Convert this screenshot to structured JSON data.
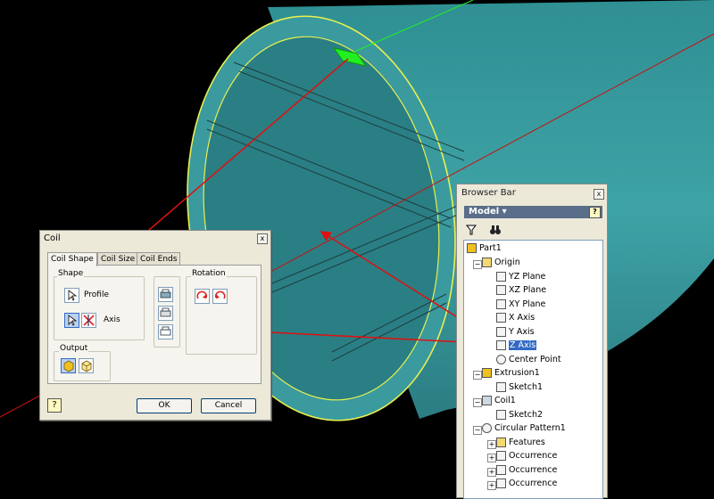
{
  "coil_dialog": {
    "title": "Coil",
    "tabs": [
      "Coil Shape",
      "Coil Size",
      "Coil Ends"
    ],
    "shape_group": "Shape",
    "profile_label": "Profile",
    "axis_label": "Axis",
    "rotation_group": "Rotation",
    "output_group": "Output",
    "ok_label": "OK",
    "cancel_label": "Cancel",
    "close_glyph": "x",
    "help_glyph": "?"
  },
  "browser_bar": {
    "title": "Browser Bar",
    "model_label": "Model ▾",
    "close_glyph": "x",
    "help_glyph": "?",
    "tree": [
      {
        "label": "Part1",
        "icon": "part-icon"
      },
      {
        "label": "Origin",
        "icon": "folder-icon"
      },
      {
        "label": "YZ Plane",
        "icon": "plane-icon"
      },
      {
        "label": "XZ Plane",
        "icon": "plane-icon"
      },
      {
        "label": "XY Plane",
        "icon": "plane-icon"
      },
      {
        "label": "X Axis",
        "icon": "axis-icon"
      },
      {
        "label": "Y Axis",
        "icon": "axis-icon"
      },
      {
        "label": "Z Axis",
        "icon": "axis-icon",
        "selected": true
      },
      {
        "label": "Center Point",
        "icon": "point-icon"
      },
      {
        "label": "Extrusion1",
        "icon": "extrusion-icon"
      },
      {
        "label": "Sketch1",
        "icon": "sketch-icon"
      },
      {
        "label": "Coil1",
        "icon": "coil-icon"
      },
      {
        "label": "Sketch2",
        "icon": "sketch-icon"
      },
      {
        "label": "Circular Pattern1",
        "icon": "pattern-icon"
      },
      {
        "label": "Features",
        "icon": "folder-icon"
      },
      {
        "label": "Occurrence",
        "icon": "occurrence-icon"
      },
      {
        "label": "Occurrence",
        "icon": "occurrence-icon"
      },
      {
        "label": "Occurrence",
        "icon": "occurrence-icon"
      }
    ]
  },
  "colors": {
    "part_cyan": "#3a9a9e",
    "edge_yellow": "#e8f050",
    "annotation_red": "#e01010",
    "selection_green": "#22ee22"
  }
}
